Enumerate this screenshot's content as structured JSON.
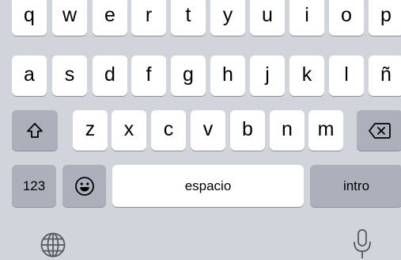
{
  "keyboard": {
    "row1": [
      "q",
      "w",
      "e",
      "r",
      "t",
      "y",
      "u",
      "i",
      "o",
      "p"
    ],
    "row2": [
      "a",
      "s",
      "d",
      "f",
      "g",
      "h",
      "j",
      "k",
      "l",
      "ñ"
    ],
    "row3": [
      "z",
      "x",
      "c",
      "v",
      "b",
      "n",
      "m"
    ],
    "numbers_label": "123",
    "space_label": "espacio",
    "return_label": "intro",
    "icons": {
      "shift": "shift-icon",
      "delete": "delete-icon",
      "emoji": "emoji-icon",
      "globe": "globe-icon",
      "microphone": "microphone-icon"
    }
  }
}
